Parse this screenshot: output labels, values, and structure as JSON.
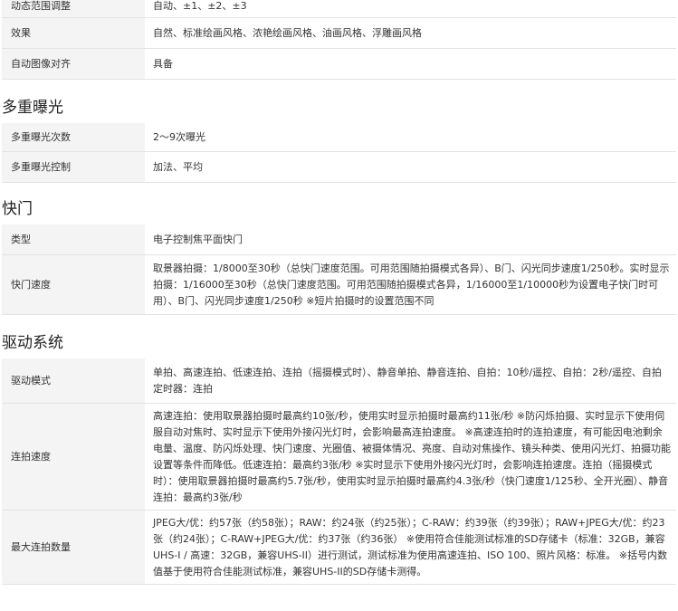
{
  "sections": {
    "top": {
      "rows": [
        {
          "label": "动态范围调整",
          "value": "自动、±1、±2、±3"
        },
        {
          "label": "效果",
          "value": "自然、标准绘画风格、浓艳绘画风格、油画风格、浮雕画风格"
        },
        {
          "label": "自动图像对齐",
          "value": "具备"
        }
      ]
    },
    "multi_exposure": {
      "title": "多重曝光",
      "rows": [
        {
          "label": "多重曝光次数",
          "value": "2～9次曝光"
        },
        {
          "label": "多重曝光控制",
          "value": "加法、平均"
        }
      ]
    },
    "shutter": {
      "title": "快门",
      "rows": [
        {
          "label": "类型",
          "value": "电子控制焦平面快门"
        },
        {
          "label": "快门速度",
          "value": "取景器拍摄：1/8000至30秒（总快门速度范围。可用范围随拍摄模式各异）、B门、闪光同步速度1/250秒。实时显示拍摄：1/16000至30秒（总快门速度范围。可用范围随拍摄模式各异，1/16000至1/10000秒为设置电子快门时可用）、B门、闪光同步速度1/250秒 ※短片拍摄时的设置范围不同"
        }
      ]
    },
    "drive": {
      "title": "驱动系统",
      "rows": [
        {
          "label": "驱动模式",
          "value": "单拍、高速连拍、低速连拍、连拍（摇摄模式时）、静音单拍、静音连拍、自拍：10秒/遥控、自拍：2秒/遥控、自拍定时器：连拍"
        },
        {
          "label": "连拍速度",
          "value": "高速连拍：使用取景器拍摄时最高约10张/秒，使用实时显示拍摄时最高约11张/秒 ※防闪烁拍摄、实时显示下使用伺服自动对焦时、实时显示下使用外接闪光灯时，会影响最高连拍速度。 ※高速连拍时的连拍速度，有可能因电池剩余电量、温度、防闪烁处理、快门速度、光圈值、被摄体情况、亮度、自动对焦操作、镜头种类、使用闪光灯、拍摄功能设置等条件而降低。低速连拍：最高约3张/秒 ※实时显示下使用外接闪光灯时，会影响连拍速度。连拍（摇摄模式时）：使用取景器拍摄时最高约5.7张/秒，使用实时显示拍摄时最高约4.3张/秒（快门速度1/125秒、全开光圈）、静音连拍：最高约3张/秒"
        },
        {
          "label": "最大连拍数量",
          "value": "JPEG大/优：约57张（约58张）；RAW：约24张（约25张）；C-RAW：约39张（约39张）；RAW+JPEG大/优：约23张（约24张）；C-RAW+JPEG大/优：约37张（约36张） ※使用符合佳能测试标准的SD存储卡（标准：32GB，兼容UHS-I / 高速：32GB，兼容UHS-II）进行测试，测试标准为使用高速连拍、ISO 100、照片风格：标准。 ※括号内数值基于使用符合佳能测试标准，兼容UHS-II的SD存储卡测得。"
        }
      ]
    }
  }
}
